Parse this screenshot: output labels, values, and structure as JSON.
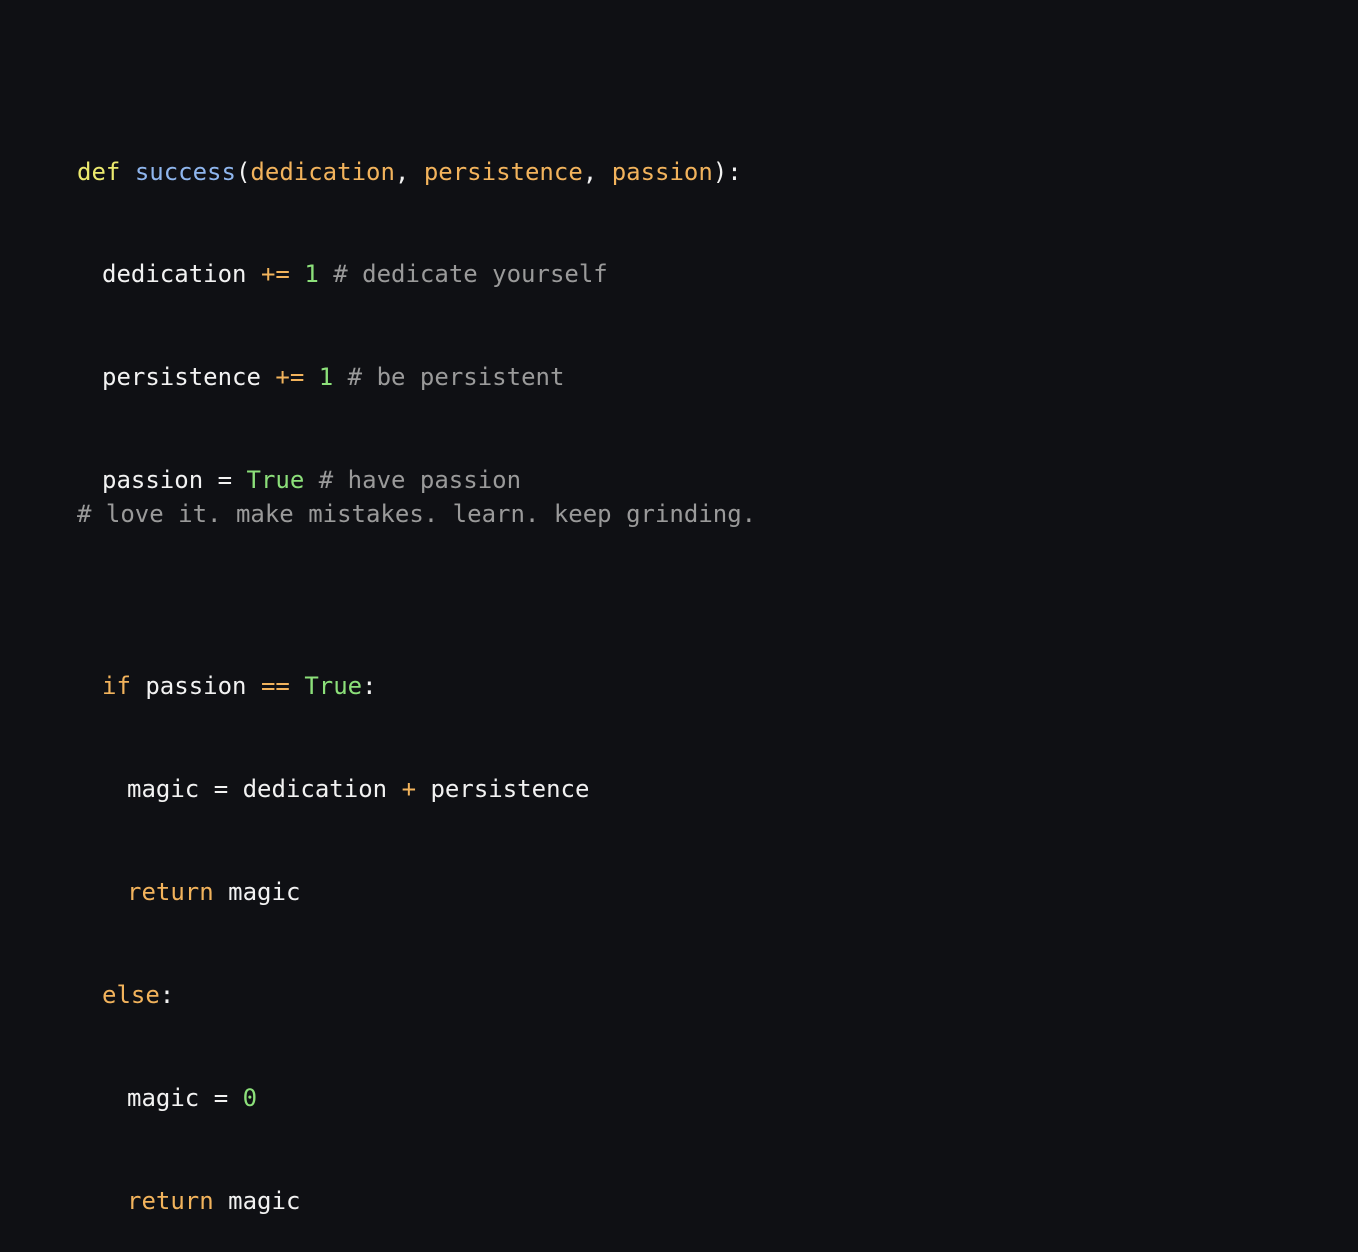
{
  "code": {
    "line1": {
      "def": "def",
      "fn": "success",
      "open": "(",
      "p1": "dedication",
      "comma1": ", ",
      "p2": "persistence",
      "comma2": ", ",
      "p3": "passion",
      "close": "):"
    },
    "line2": {
      "var": "dedication",
      "op": "+=",
      "num": "1",
      "comment": "# dedicate yourself"
    },
    "line3": {
      "var": "persistence",
      "op": "+=",
      "num": "1",
      "comment": "# be persistent"
    },
    "line4": {
      "var": "passion",
      "op": "=",
      "val": "True",
      "comment": "# have passion"
    },
    "line6": {
      "kw": "if",
      "var": "passion",
      "op": "==",
      "val": "True",
      "colon": ":"
    },
    "line7": {
      "var": "magic",
      "op": "=",
      "a": "dedication",
      "plus": "+",
      "b": "persistence"
    },
    "line8": {
      "kw": "return",
      "var": "magic"
    },
    "line9": {
      "kw": "else",
      "colon": ":"
    },
    "line10": {
      "var": "magic",
      "op": "=",
      "num": "0"
    },
    "line11": {
      "kw": "return",
      "var": "magic"
    }
  },
  "footer_comment": "# love it. make mistakes. learn. keep grinding.",
  "colors": {
    "background": "#0f1014",
    "keyword_def": "#ecea6e",
    "function_name": "#8fb6ee",
    "keyword_param": "#f2b35c",
    "literal": "#8ce07a",
    "comment": "#9a9a9a",
    "text": "#f2f2f2"
  }
}
